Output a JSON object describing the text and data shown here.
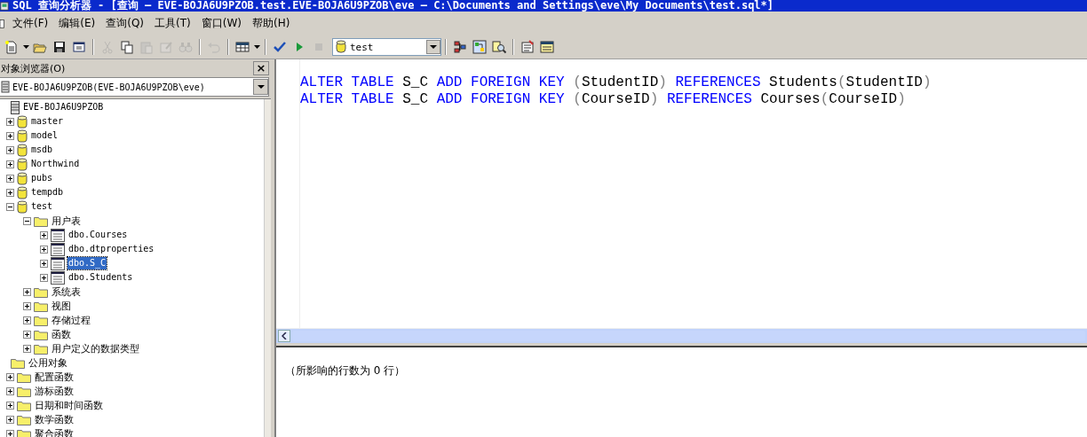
{
  "window": {
    "title": "SQL 查询分析器 - [查询 — EVE-BOJA6U9PZOB.test.EVE-BOJA6U9PZOB\\eve — C:\\Documents and Settings\\eve\\My Documents\\test.sql*]"
  },
  "menu": [
    "文件(F)",
    "编辑(E)",
    "查询(Q)",
    "工具(T)",
    "窗口(W)",
    "帮助(H)"
  ],
  "toolbar": [
    {
      "kind": "new",
      "disabled": false
    },
    {
      "kind": "caret",
      "disabled": false
    },
    {
      "kind": "open",
      "disabled": false
    },
    {
      "kind": "save",
      "disabled": false
    },
    {
      "kind": "window",
      "disabled": false
    },
    {
      "kind": "sep"
    },
    {
      "kind": "cut",
      "disabled": true
    },
    {
      "kind": "copy",
      "disabled": false
    },
    {
      "kind": "paste",
      "disabled": true
    },
    {
      "kind": "edit",
      "disabled": true
    },
    {
      "kind": "find",
      "disabled": true
    },
    {
      "kind": "sep"
    },
    {
      "kind": "undo",
      "disabled": true
    },
    {
      "kind": "sep"
    },
    {
      "kind": "grid",
      "disabled": false
    },
    {
      "kind": "caret",
      "disabled": false
    },
    {
      "kind": "sep"
    },
    {
      "kind": "check",
      "disabled": false
    },
    {
      "kind": "run",
      "disabled": false
    },
    {
      "kind": "stop",
      "disabled": true
    },
    {
      "kind": "database"
    },
    {
      "kind": "sep"
    },
    {
      "kind": "plan",
      "disabled": false
    },
    {
      "kind": "browser",
      "disabled": false
    },
    {
      "kind": "search",
      "disabled": false
    },
    {
      "kind": "sep"
    },
    {
      "kind": "properties",
      "disabled": false
    },
    {
      "kind": "results",
      "disabled": false
    }
  ],
  "database_selector": {
    "value": "test"
  },
  "object_browser": {
    "title": "对象浏览器(O)",
    "close": "×",
    "server_selector": {
      "value": "EVE-BOJA6U9PZOB(EVE-BOJA6U9PZOB\\eve)"
    },
    "tree": [
      {
        "label": "EVE-BOJA6U9PZOB",
        "kind": "server",
        "selected": false,
        "children": [
          {
            "label": "master",
            "kind": "database",
            "expanded": false,
            "selected": false
          },
          {
            "label": "model",
            "kind": "database",
            "expanded": false,
            "selected": false
          },
          {
            "label": "msdb",
            "kind": "database",
            "expanded": false,
            "selected": false
          },
          {
            "label": "Northwind",
            "kind": "database",
            "expanded": false,
            "selected": false
          },
          {
            "label": "pubs",
            "kind": "database",
            "expanded": false,
            "selected": false
          },
          {
            "label": "tempdb",
            "kind": "database",
            "expanded": false,
            "selected": false
          },
          {
            "label": "test",
            "kind": "database",
            "expanded": true,
            "selected": false,
            "children": [
              {
                "label": "用户表",
                "kind": "folder",
                "expanded": true,
                "selected": false,
                "children": [
                  {
                    "label": "dbo.Courses",
                    "kind": "table",
                    "expanded": false,
                    "selected": false
                  },
                  {
                    "label": "dbo.dtproperties",
                    "kind": "table",
                    "expanded": false,
                    "selected": false
                  },
                  {
                    "label": "dbo.S_C",
                    "kind": "table",
                    "expanded": false,
                    "selected": true
                  },
                  {
                    "label": "dbo.Students",
                    "kind": "table",
                    "expanded": false,
                    "selected": false
                  }
                ]
              },
              {
                "label": "系统表",
                "kind": "folder",
                "expanded": false,
                "selected": false
              },
              {
                "label": "视图",
                "kind": "folder",
                "expanded": false,
                "selected": false
              },
              {
                "label": "存储过程",
                "kind": "folder",
                "expanded": false,
                "selected": false
              },
              {
                "label": "函数",
                "kind": "folder",
                "expanded": false,
                "selected": false
              },
              {
                "label": "用户定义的数据类型",
                "kind": "folder",
                "expanded": false,
                "selected": false
              }
            ]
          }
        ]
      },
      {
        "label": "公用对象",
        "kind": "folder",
        "selected": false,
        "children": [
          {
            "label": "配置函数",
            "kind": "folder",
            "expanded": false,
            "selected": false
          },
          {
            "label": "游标函数",
            "kind": "folder",
            "expanded": false,
            "selected": false
          },
          {
            "label": "日期和时间函数",
            "kind": "folder",
            "expanded": false,
            "selected": false
          },
          {
            "label": "数学函数",
            "kind": "folder",
            "expanded": false,
            "selected": false
          },
          {
            "label": "聚合函数",
            "kind": "folder",
            "expanded": false,
            "selected": false
          }
        ]
      }
    ]
  },
  "editor": {
    "lines": [
      [
        {
          "text": "ALTER TABLE",
          "kind": "keyword"
        },
        {
          "text": " S_C ",
          "kind": "ident"
        },
        {
          "text": "ADD FOREIGN KEY",
          "kind": "keyword"
        },
        {
          "text": " (",
          "kind": "punct"
        },
        {
          "text": "StudentID",
          "kind": "ident"
        },
        {
          "text": ") ",
          "kind": "punct"
        },
        {
          "text": "REFERENCES",
          "kind": "keyword"
        },
        {
          "text": " Students",
          "kind": "ident"
        },
        {
          "text": "(",
          "kind": "punct"
        },
        {
          "text": "StudentID",
          "kind": "ident"
        },
        {
          "text": ")",
          "kind": "punct"
        }
      ],
      [
        {
          "text": "ALTER TABLE",
          "kind": "keyword"
        },
        {
          "text": " S_C ",
          "kind": "ident"
        },
        {
          "text": "ADD FOREIGN KEY",
          "kind": "keyword"
        },
        {
          "text": " (",
          "kind": "punct"
        },
        {
          "text": "CourseID",
          "kind": "ident"
        },
        {
          "text": ") ",
          "kind": "punct"
        },
        {
          "text": "REFERENCES",
          "kind": "keyword"
        },
        {
          "text": " Courses",
          "kind": "ident"
        },
        {
          "text": "(",
          "kind": "punct"
        },
        {
          "text": "CourseID",
          "kind": "ident"
        },
        {
          "text": ")",
          "kind": "punct"
        }
      ]
    ]
  },
  "results": {
    "message": "（所影响的行数为 0 行）"
  }
}
